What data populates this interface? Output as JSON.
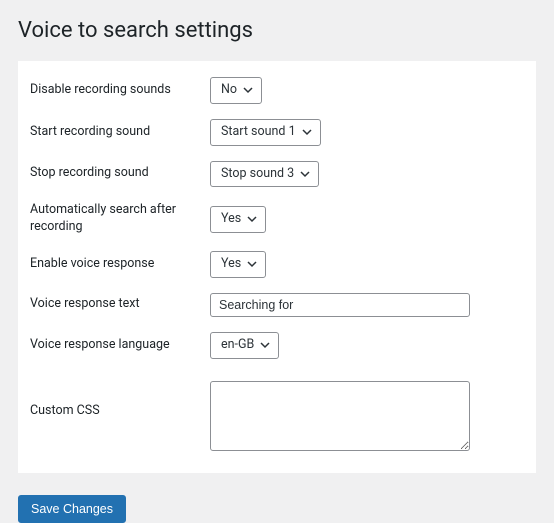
{
  "page": {
    "title": "Voice to search settings"
  },
  "fields": {
    "disable_sounds": {
      "label": "Disable recording sounds",
      "value": "No"
    },
    "start_sound": {
      "label": "Start recording sound",
      "value": "Start sound 1"
    },
    "stop_sound": {
      "label": "Stop recording sound",
      "value": "Stop sound 3"
    },
    "auto_search": {
      "label": "Automatically search after recording",
      "value": "Yes"
    },
    "enable_voice": {
      "label": "Enable voice response",
      "value": "Yes"
    },
    "response_text": {
      "label": "Voice response text",
      "value": "Searching for"
    },
    "response_lang": {
      "label": "Voice response language",
      "value": "en-GB"
    },
    "custom_css": {
      "label": "Custom CSS",
      "value": ""
    }
  },
  "buttons": {
    "save": "Save Changes"
  }
}
